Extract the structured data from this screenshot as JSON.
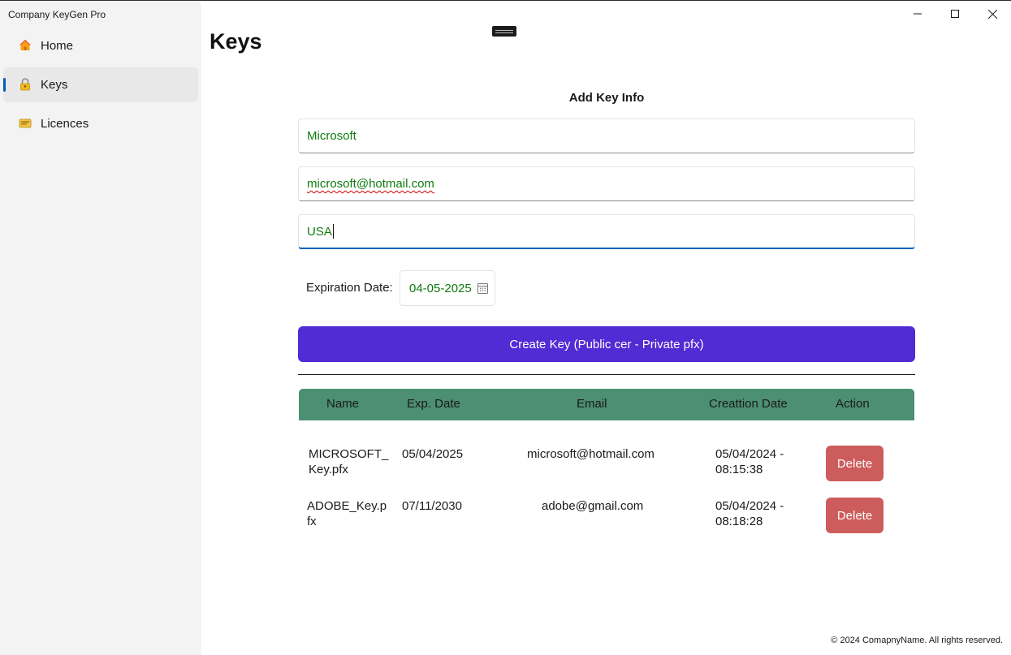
{
  "app": {
    "title": "Company KeyGen Pro"
  },
  "sidebar": {
    "items": [
      {
        "label": "Home",
        "icon": "home-icon"
      },
      {
        "label": "Keys",
        "icon": "lock-icon",
        "selected": true
      },
      {
        "label": "Licences",
        "icon": "license-card-icon"
      }
    ]
  },
  "page": {
    "title": "Keys"
  },
  "form": {
    "heading": "Add Key Info",
    "name_value": "Microsoft",
    "email_value": "microsoft@hotmail.com",
    "country_value": "USA",
    "expiration_label": "Expiration Date:",
    "expiration_value": "04-05-2025",
    "create_button": "Create Key (Public cer - Private pfx)"
  },
  "table": {
    "headers": [
      "Name",
      "Exp. Date",
      "Email",
      "Creattion Date",
      "Action"
    ],
    "rows": [
      {
        "name_l1": "MICROSOFT_",
        "name_l2": "Key.pfx",
        "exp": "05/04/2025",
        "email": "microsoft@hotmail.com",
        "created_l1": "05/04/2024 -",
        "created_l2": "08:15:38",
        "action": "Delete"
      },
      {
        "name_l1": "ADOBE_Key.p",
        "name_l2": "fx",
        "exp": "07/11/2030",
        "email": "adobe@gmail.com",
        "created_l1": "05/04/2024 -",
        "created_l2": "08:18:28",
        "action": "Delete"
      }
    ]
  },
  "footer": {
    "text": "© 2024 ComapnyName. All rights reserved."
  },
  "colors": {
    "accent": "#512bd4",
    "table_header": "#4c8f73",
    "delete": "#cd5c5c",
    "input_text": "#0f7b0f",
    "nav_indicator": "#005fb8"
  }
}
